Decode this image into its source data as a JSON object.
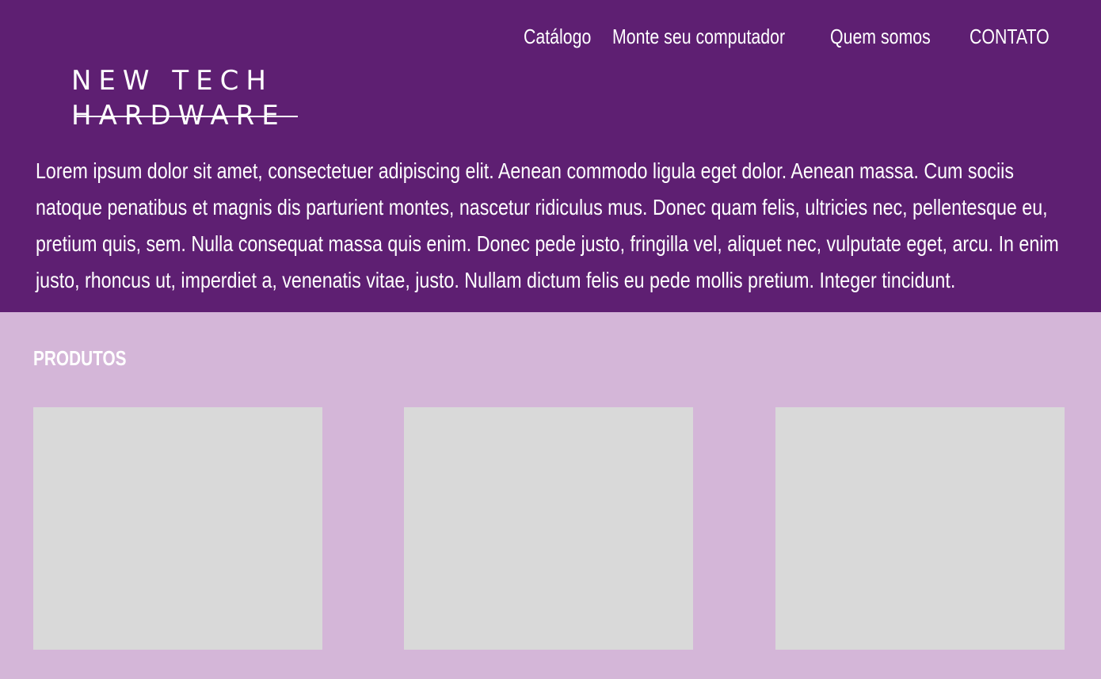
{
  "nav": {
    "items": [
      {
        "label": "Catálogo"
      },
      {
        "label": "Monte seu computador"
      },
      {
        "label": "Quem somos"
      },
      {
        "label": "CONTATO"
      }
    ]
  },
  "logo": {
    "line1": "NEW TECH",
    "line2": "HARDWARE"
  },
  "intro": {
    "text": "Lorem ipsum dolor sit amet, consectetuer adipiscing elit. Aenean commodo ligula eget dolor. Aenean massa. Cum sociis natoque penatibus et magnis dis parturient montes, nascetur ridiculus mus. Donec quam felis, ultricies nec, pellentesque eu, pretium quis, sem. Nulla consequat massa quis enim. Donec pede justo, fringilla vel, aliquet nec, vulputate eget, arcu. In enim justo, rhoncus ut, imperdiet a, venenatis vitae, justo. Nullam dictum felis eu pede mollis pretium. Integer tincidunt."
  },
  "products": {
    "title": "PRODUTOS"
  },
  "colors": {
    "header_bg": "#5e1f72",
    "page_bg": "#d4b6d8",
    "card_bg": "#d9d9d9",
    "text": "#ffffff"
  }
}
